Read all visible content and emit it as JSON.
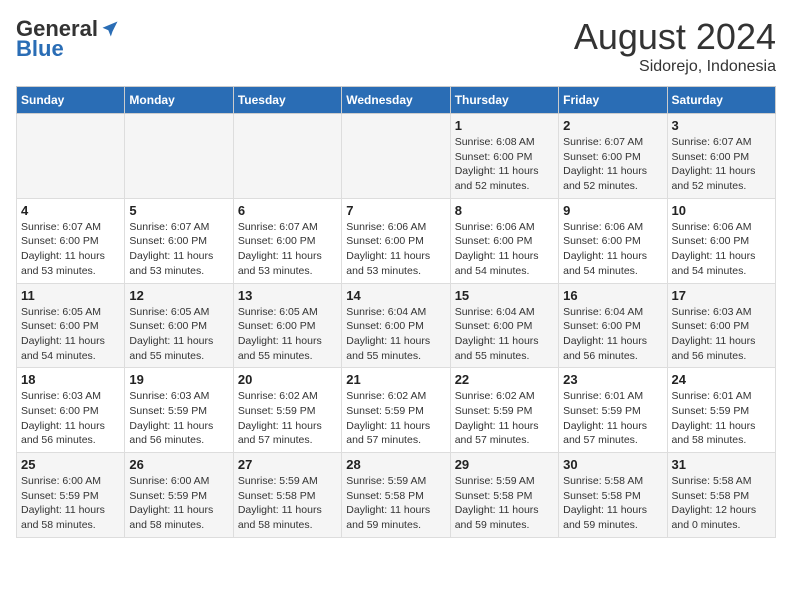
{
  "logo": {
    "general": "General",
    "blue": "Blue"
  },
  "title": {
    "month_year": "August 2024",
    "location": "Sidorejo, Indonesia"
  },
  "days_of_week": [
    "Sunday",
    "Monday",
    "Tuesday",
    "Wednesday",
    "Thursday",
    "Friday",
    "Saturday"
  ],
  "weeks": [
    [
      {
        "day": "",
        "detail": ""
      },
      {
        "day": "",
        "detail": ""
      },
      {
        "day": "",
        "detail": ""
      },
      {
        "day": "",
        "detail": ""
      },
      {
        "day": "1",
        "detail": "Sunrise: 6:08 AM\nSunset: 6:00 PM\nDaylight: 11 hours\nand 52 minutes."
      },
      {
        "day": "2",
        "detail": "Sunrise: 6:07 AM\nSunset: 6:00 PM\nDaylight: 11 hours\nand 52 minutes."
      },
      {
        "day": "3",
        "detail": "Sunrise: 6:07 AM\nSunset: 6:00 PM\nDaylight: 11 hours\nand 52 minutes."
      }
    ],
    [
      {
        "day": "4",
        "detail": "Sunrise: 6:07 AM\nSunset: 6:00 PM\nDaylight: 11 hours\nand 53 minutes."
      },
      {
        "day": "5",
        "detail": "Sunrise: 6:07 AM\nSunset: 6:00 PM\nDaylight: 11 hours\nand 53 minutes."
      },
      {
        "day": "6",
        "detail": "Sunrise: 6:07 AM\nSunset: 6:00 PM\nDaylight: 11 hours\nand 53 minutes."
      },
      {
        "day": "7",
        "detail": "Sunrise: 6:06 AM\nSunset: 6:00 PM\nDaylight: 11 hours\nand 53 minutes."
      },
      {
        "day": "8",
        "detail": "Sunrise: 6:06 AM\nSunset: 6:00 PM\nDaylight: 11 hours\nand 54 minutes."
      },
      {
        "day": "9",
        "detail": "Sunrise: 6:06 AM\nSunset: 6:00 PM\nDaylight: 11 hours\nand 54 minutes."
      },
      {
        "day": "10",
        "detail": "Sunrise: 6:06 AM\nSunset: 6:00 PM\nDaylight: 11 hours\nand 54 minutes."
      }
    ],
    [
      {
        "day": "11",
        "detail": "Sunrise: 6:05 AM\nSunset: 6:00 PM\nDaylight: 11 hours\nand 54 minutes."
      },
      {
        "day": "12",
        "detail": "Sunrise: 6:05 AM\nSunset: 6:00 PM\nDaylight: 11 hours\nand 55 minutes."
      },
      {
        "day": "13",
        "detail": "Sunrise: 6:05 AM\nSunset: 6:00 PM\nDaylight: 11 hours\nand 55 minutes."
      },
      {
        "day": "14",
        "detail": "Sunrise: 6:04 AM\nSunset: 6:00 PM\nDaylight: 11 hours\nand 55 minutes."
      },
      {
        "day": "15",
        "detail": "Sunrise: 6:04 AM\nSunset: 6:00 PM\nDaylight: 11 hours\nand 55 minutes."
      },
      {
        "day": "16",
        "detail": "Sunrise: 6:04 AM\nSunset: 6:00 PM\nDaylight: 11 hours\nand 56 minutes."
      },
      {
        "day": "17",
        "detail": "Sunrise: 6:03 AM\nSunset: 6:00 PM\nDaylight: 11 hours\nand 56 minutes."
      }
    ],
    [
      {
        "day": "18",
        "detail": "Sunrise: 6:03 AM\nSunset: 6:00 PM\nDaylight: 11 hours\nand 56 minutes."
      },
      {
        "day": "19",
        "detail": "Sunrise: 6:03 AM\nSunset: 5:59 PM\nDaylight: 11 hours\nand 56 minutes."
      },
      {
        "day": "20",
        "detail": "Sunrise: 6:02 AM\nSunset: 5:59 PM\nDaylight: 11 hours\nand 57 minutes."
      },
      {
        "day": "21",
        "detail": "Sunrise: 6:02 AM\nSunset: 5:59 PM\nDaylight: 11 hours\nand 57 minutes."
      },
      {
        "day": "22",
        "detail": "Sunrise: 6:02 AM\nSunset: 5:59 PM\nDaylight: 11 hours\nand 57 minutes."
      },
      {
        "day": "23",
        "detail": "Sunrise: 6:01 AM\nSunset: 5:59 PM\nDaylight: 11 hours\nand 57 minutes."
      },
      {
        "day": "24",
        "detail": "Sunrise: 6:01 AM\nSunset: 5:59 PM\nDaylight: 11 hours\nand 58 minutes."
      }
    ],
    [
      {
        "day": "25",
        "detail": "Sunrise: 6:00 AM\nSunset: 5:59 PM\nDaylight: 11 hours\nand 58 minutes."
      },
      {
        "day": "26",
        "detail": "Sunrise: 6:00 AM\nSunset: 5:59 PM\nDaylight: 11 hours\nand 58 minutes."
      },
      {
        "day": "27",
        "detail": "Sunrise: 5:59 AM\nSunset: 5:58 PM\nDaylight: 11 hours\nand 58 minutes."
      },
      {
        "day": "28",
        "detail": "Sunrise: 5:59 AM\nSunset: 5:58 PM\nDaylight: 11 hours\nand 59 minutes."
      },
      {
        "day": "29",
        "detail": "Sunrise: 5:59 AM\nSunset: 5:58 PM\nDaylight: 11 hours\nand 59 minutes."
      },
      {
        "day": "30",
        "detail": "Sunrise: 5:58 AM\nSunset: 5:58 PM\nDaylight: 11 hours\nand 59 minutes."
      },
      {
        "day": "31",
        "detail": "Sunrise: 5:58 AM\nSunset: 5:58 PM\nDaylight: 12 hours\nand 0 minutes."
      }
    ]
  ]
}
